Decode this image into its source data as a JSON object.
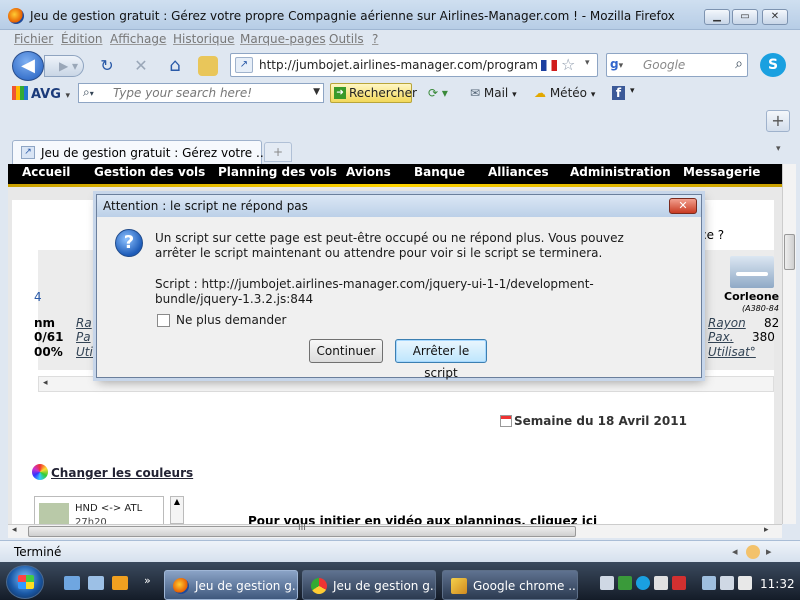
{
  "window": {
    "title": "Jeu de gestion gratuit : Gérez votre propre Compagnie aérienne sur Airlines-Manager.com ! - Mozilla Firefox",
    "min_glyph": "▁",
    "max_glyph": "▭",
    "close_glyph": "✕"
  },
  "menu": [
    "Fichier",
    "Édition",
    "Affichage",
    "Historique",
    "Marque-pages",
    "Outils",
    "?"
  ],
  "nav": {
    "back_glyph": "◀",
    "forward_glyph": "▶ ▾",
    "reload_glyph": "↻",
    "stop_glyph": "✕",
    "home_glyph": "⌂",
    "url": "http://jumbojet.airlines-manager.com/programmat",
    "search_placeholder": "Google",
    "star_glyph": "☆",
    "drop_glyph": "▾",
    "search_glyph": "⌕",
    "skype_glyph": "S"
  },
  "toolbar": {
    "avg_label": "AVG",
    "avg_search_placeholder": "Type your search here!",
    "search_button": "Rechercher",
    "mail": "Mail",
    "weather": "Météo",
    "facebook": "f"
  },
  "tabs": {
    "active_label": "Jeu de gestion gratuit : Gérez votre ...",
    "new_tab_glyph": "+",
    "plus_glyph": "+",
    "list_glyph": "▾"
  },
  "site_nav": [
    "Accueil",
    "Gestion des vols",
    "Planning des vols",
    "Avions",
    "Banque",
    "Alliances",
    "Administration",
    "Messagerie"
  ],
  "page": {
    "question_fragment": "ce ?",
    "left_col": [
      "4",
      "nm",
      "0/61",
      "00%"
    ],
    "mid_col": [
      "Ra",
      "Pa",
      "Util"
    ],
    "plane_name": "Corleone",
    "plane_model": "(A380-84",
    "rayon": "Rayon",
    "rayon_val": "82",
    "pax": "Pax.",
    "pax_val": "380",
    "utilisat": "Utilisat°",
    "semaine": "Semaine du 18 Avril 2011",
    "change_colors": "Changer les couleurs",
    "route": "HND <-> ATL",
    "route_time": "27h20",
    "video_text": "Pour vous initier en vidéo aux plannings, cliquez ici",
    "scroll_left": "◂",
    "scroll_right": "▸",
    "scroll_grip": "III",
    "scroll_up": "▲"
  },
  "status": {
    "text": "Terminé"
  },
  "dialog": {
    "title": "Attention : le script ne répond pas",
    "close_glyph": "✕",
    "question_glyph": "?",
    "message": "Un script sur cette page est peut-être occupé ou ne répond plus. Vous pouvez arrêter le script maintenant ou attendre pour voir si le script se terminera.",
    "script_label": "Script : http://jumbojet.airlines-manager.com/jquery-ui-1-1/development-bundle/jquery-1.3.2.js:844",
    "checkbox_label": "Ne plus demander",
    "continue_button": "Continuer",
    "stop_button": "Arrêter le script"
  },
  "taskbar": {
    "items": [
      "Jeu de gestion g...",
      "Jeu de gestion g...",
      "Google chrome ..."
    ],
    "clock": "11:32",
    "more_glyph": "»"
  }
}
